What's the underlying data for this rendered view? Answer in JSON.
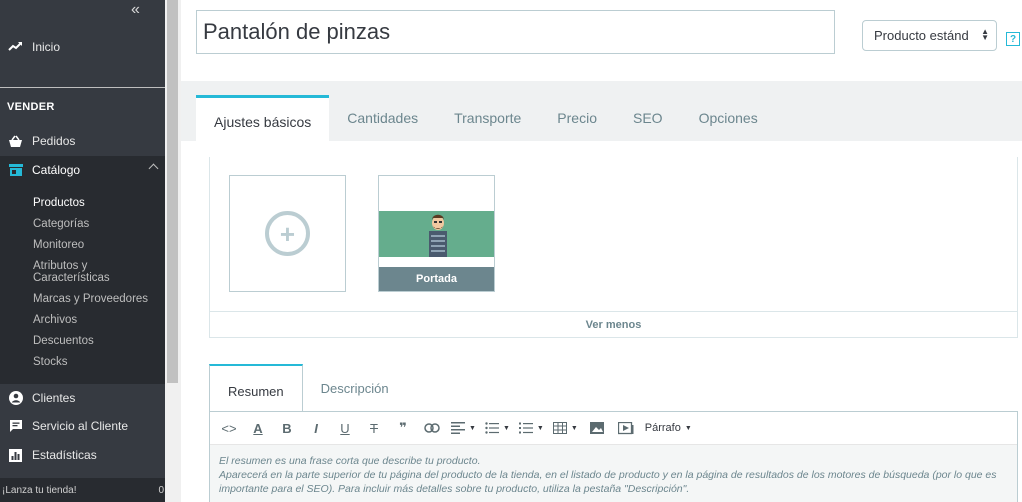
{
  "sidebar": {
    "collapse_label": "«",
    "home_label": "Inicio",
    "section_title": "VENDER",
    "orders_label": "Pedidos",
    "catalog_label": "Catálogo",
    "catalog_sub": [
      "Productos",
      "Categorías",
      "Monitoreo",
      "Atributos y\nCaracterísticas",
      "Marcas y Proveedores",
      "Archivos",
      "Descuentos",
      "Stocks"
    ],
    "customers_label": "Clientes",
    "service_label": "Servicio al Cliente",
    "stats_label": "Estadísticas",
    "footer_text": "¡Lanza tu tienda!",
    "footer_count": "0"
  },
  "header": {
    "product_name": "Pantalón de pinzas",
    "product_type": "Producto estánd",
    "help_label": "?"
  },
  "tabs": [
    "Ajustes básicos",
    "Cantidades",
    "Transporte",
    "Precio",
    "SEO",
    "Opciones"
  ],
  "images": {
    "add_symbol": "+",
    "cover_label": "Portada",
    "see_less": "Ver menos"
  },
  "description_tabs": [
    "Resumen",
    "Descripción"
  ],
  "editor": {
    "format_label": "Párrafo",
    "placeholder_line1": "El resumen es una frase corta que describe tu producto.",
    "placeholder_line2": "Aparecerá en la parte superior de tu página del producto de la tienda, en el listado de producto y en la página de resultados de los motores de búsqueda (por lo que es importante para el SEO). Para incluir más detalles sobre tu producto, utiliza la pestaña \"Descripción\"."
  },
  "colors": {
    "sidebar_bg": "#363a41",
    "accent": "#25b9d7",
    "cover_bg": "#65ad8d",
    "label_bg": "#6c868e"
  }
}
